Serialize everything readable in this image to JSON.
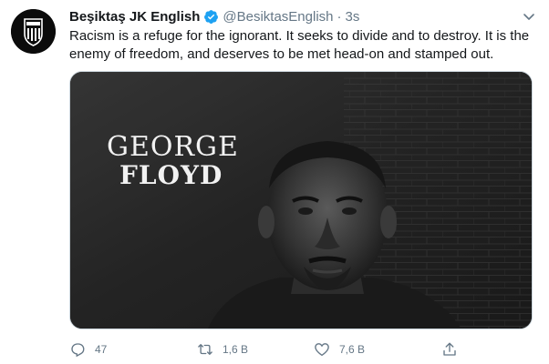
{
  "colors": {
    "text": "#14171a",
    "secondary": "#657786",
    "verified": "#1da1f2",
    "border": "#ccd6dd"
  },
  "tweet": {
    "author": {
      "display_name": "Beşiktaş JK English",
      "handle": "@BesiktasEnglish",
      "separator": "·",
      "time": "3s",
      "avatar_icon": "besiktas-crest-icon",
      "verified_icon": "verified-badge-icon"
    },
    "text": "Racism is a refuge for the ignorant. It seeks to divide and to destroy. It is the enemy of freedom, and deserves to be met head-on and stamped out.",
    "media": {
      "overlay_first": "GEORGE",
      "overlay_last": "FLOYD"
    },
    "actions": {
      "reply": {
        "icon": "reply-icon",
        "count": "47"
      },
      "retweet": {
        "icon": "retweet-icon",
        "count": "1,6 B"
      },
      "like": {
        "icon": "heart-icon",
        "count": "7,6 B"
      },
      "share": {
        "icon": "share-icon"
      }
    },
    "menu_icon": "chevron-down-icon"
  }
}
